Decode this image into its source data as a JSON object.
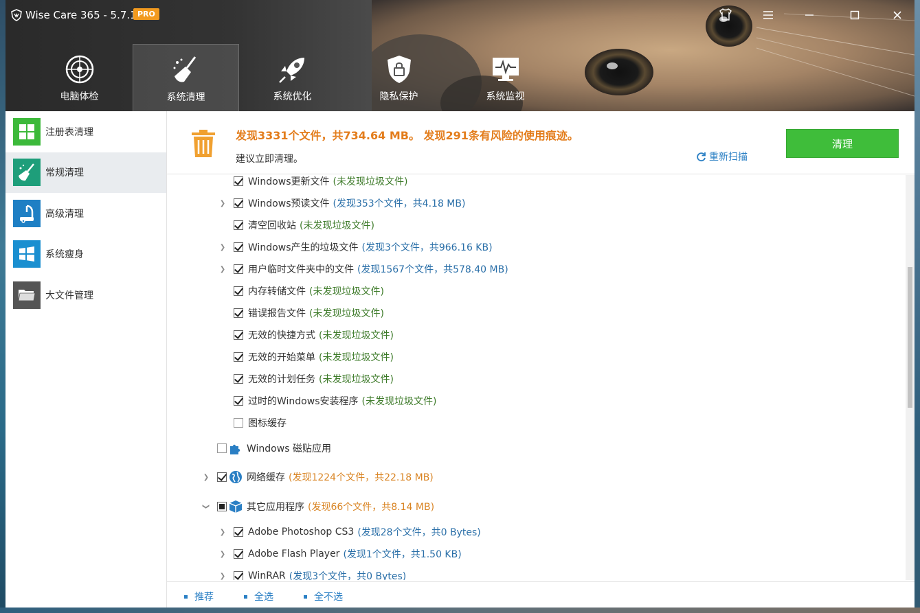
{
  "app": {
    "title": "Wise Care 365 - 5.7.1",
    "badge": "PRO",
    "controls": {
      "skin": "tshirt-icon",
      "minimize": "—",
      "maximize": "☐",
      "close": "✕"
    }
  },
  "nav": [
    {
      "label": "电脑体检",
      "icon": "radar-icon"
    },
    {
      "label": "系统清理",
      "icon": "broom-icon",
      "active": true
    },
    {
      "label": "系统优化",
      "icon": "rocket-icon"
    },
    {
      "label": "隐私保护",
      "icon": "shield-lock-icon"
    },
    {
      "label": "系统监视",
      "icon": "monitor-pulse-icon"
    }
  ],
  "sidebar": {
    "items": [
      {
        "label": "注册表清理",
        "icon": "registry-grid-icon",
        "color": "#3cb93a"
      },
      {
        "label": "常规清理",
        "icon": "broom-icon",
        "color": "#1e9e7a",
        "active": true
      },
      {
        "label": "高级清理",
        "icon": "vacuum-icon",
        "color": "#1e7fc4"
      },
      {
        "label": "系统瘦身",
        "icon": "windows-icon",
        "color": "#1a8fd0"
      },
      {
        "label": "大文件管理",
        "icon": "folder-icon",
        "color": "#555555"
      }
    ]
  },
  "summary": {
    "headline": "发现3331个文件，共734.64 MB。 发现291条有风险的使用痕迹。",
    "advice": "建议立即清理。",
    "rescan": "重新扫描",
    "clean_button": "清理"
  },
  "list": {
    "rows": [
      {
        "name": "Windows更新文件",
        "note": "(未发现垃圾文件)",
        "note_type": "none",
        "checked": "checked",
        "expand": false
      },
      {
        "name": "Windows预读文件",
        "note": "(发现353个文件，共4.18 MB)",
        "note_type": "found-blue",
        "checked": "checked",
        "expand": true
      },
      {
        "name": "清空回收站",
        "note": "(未发现垃圾文件)",
        "note_type": "none",
        "checked": "checked",
        "expand": false
      },
      {
        "name": "Windows产生的垃圾文件",
        "note": "(发现3个文件，共966.16 KB)",
        "note_type": "found-blue",
        "checked": "checked",
        "expand": true
      },
      {
        "name": "用户临时文件夹中的文件",
        "note": "(发现1567个文件，共578.40 MB)",
        "note_type": "found-blue",
        "checked": "checked",
        "expand": true
      },
      {
        "name": "内存转储文件",
        "note": "(未发现垃圾文件)",
        "note_type": "none",
        "checked": "checked",
        "expand": false
      },
      {
        "name": "错误报告文件",
        "note": "(未发现垃圾文件)",
        "note_type": "none",
        "checked": "checked",
        "expand": false
      },
      {
        "name": "无效的快捷方式",
        "note": "(未发现垃圾文件)",
        "note_type": "none",
        "checked": "checked",
        "expand": false
      },
      {
        "name": "无效的开始菜单",
        "note": "(未发现垃圾文件)",
        "note_type": "none",
        "checked": "checked",
        "expand": false
      },
      {
        "name": "无效的计划任务",
        "note": "(未发现垃圾文件)",
        "note_type": "none",
        "checked": "checked",
        "expand": false
      },
      {
        "name": "过时的Windows安装程序",
        "note": "(未发现垃圾文件)",
        "note_type": "none",
        "checked": "checked",
        "expand": false
      },
      {
        "name": "图标缓存",
        "note": "",
        "note_type": "none",
        "checked": "unchecked",
        "expand": false
      }
    ],
    "groups": [
      {
        "name": "Windows 磁贴应用",
        "note": "",
        "checked": "unchecked",
        "icon": "puzzle-icon",
        "expand": false
      },
      {
        "name": "网络缓存",
        "note": "(发现1224个文件，共22.18 MB)",
        "checked": "checked",
        "icon": "globe-icon",
        "expand": true
      },
      {
        "name": "其它应用程序",
        "note": "(发现66个文件，共8.14 MB)",
        "checked": "partial",
        "icon": "box-icon",
        "expand": "open"
      }
    ],
    "app_rows": [
      {
        "name": "Adobe Photoshop CS3",
        "note": "(发现28个文件，共0 Bytes)",
        "checked": "checked"
      },
      {
        "name": "Adobe Flash Player",
        "note": "(发现1个文件，共1.50 KB)",
        "checked": "checked"
      },
      {
        "name": "WinRAR",
        "note": "(发现3个文件，共0 Bytes)",
        "checked": "checked"
      }
    ]
  },
  "footer": {
    "recommend": "推荐",
    "select_all": "全选",
    "select_none": "全不选"
  },
  "colors": {
    "accent_green": "#3fbd3a",
    "warning_orange": "#e37d1c",
    "link_blue": "#2a7fc4"
  }
}
